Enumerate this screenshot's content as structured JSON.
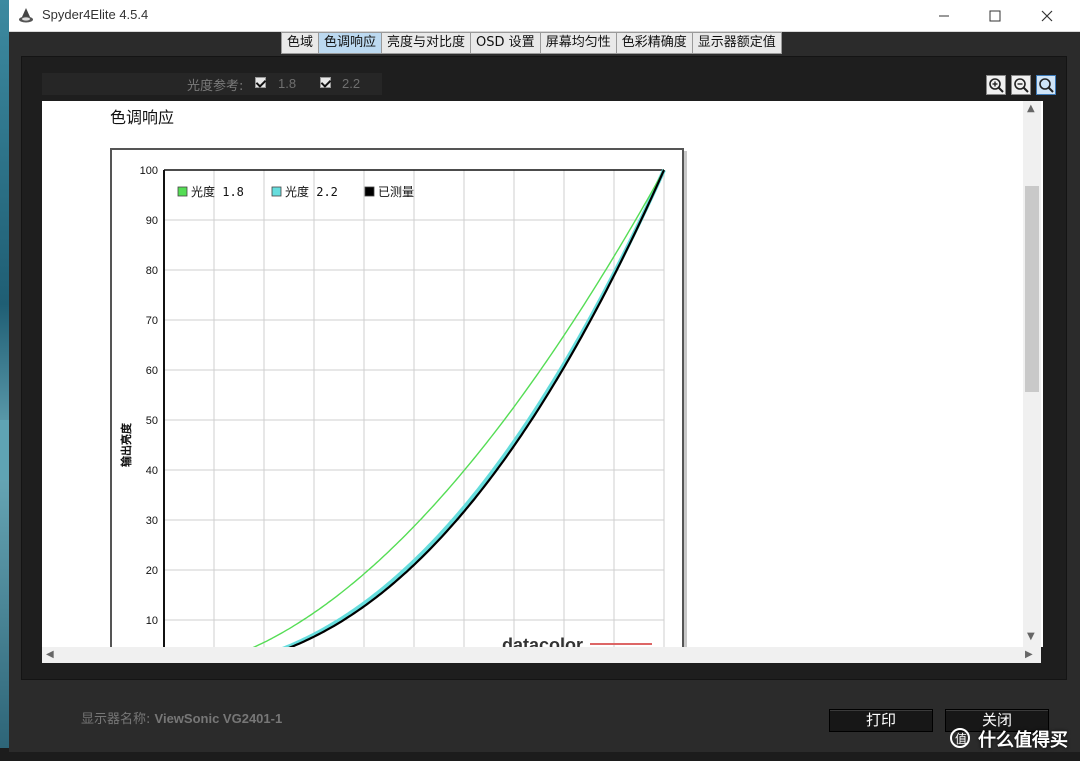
{
  "window": {
    "title": "Spyder4Elite 4.5.4",
    "min_icon": "minimize-icon",
    "max_icon": "maximize-icon",
    "close_icon": "close-icon"
  },
  "tabs": [
    {
      "label": "色域",
      "active": false
    },
    {
      "label": "色调响应",
      "active": true
    },
    {
      "label": "亮度与对比度",
      "active": false
    },
    {
      "label": "OSD 设置",
      "active": false
    },
    {
      "label": "屏幕均匀性",
      "active": false
    },
    {
      "label": "色彩精确度",
      "active": false
    },
    {
      "label": "显示器额定值",
      "active": false
    }
  ],
  "reference": {
    "label": "光度参考:",
    "options": [
      {
        "value": "1.8",
        "checked": true
      },
      {
        "value": "2.2",
        "checked": true
      }
    ]
  },
  "zoom": {
    "zoom_in_icon": "zoom-in-icon",
    "zoom_out_icon": "zoom-out-icon",
    "zoom_fit_icon": "zoom-fit-icon"
  },
  "section": {
    "title": "色调响应"
  },
  "chart_data": {
    "type": "line",
    "ylabel": "输出亮度",
    "xlabel": "",
    "ylim": [
      0,
      100
    ],
    "xlim": [
      0,
      100
    ],
    "yticks": [
      "10",
      "20",
      "30",
      "40",
      "50",
      "60",
      "70",
      "80",
      "90",
      "100"
    ],
    "grid": true,
    "legend_position": "top-left",
    "series": [
      {
        "name": "光度 1.8",
        "color": "#55dd55",
        "gamma": 1.8,
        "x": [
          40,
          50,
          60,
          70,
          80,
          90,
          100
        ],
        "y": [
          19.2,
          28.7,
          39.9,
          52.6,
          66.9,
          82.7,
          100
        ]
      },
      {
        "name": "光度 2.2",
        "color": "#66dddd",
        "gamma": 2.2,
        "x": [
          40,
          50,
          60,
          70,
          80,
          90,
          100
        ],
        "y": [
          13.3,
          21.8,
          32.5,
          45.6,
          61.2,
          79.3,
          100
        ]
      },
      {
        "name": "已测量",
        "color": "#000000",
        "gamma": 2.25,
        "x": [
          40,
          50,
          60,
          70,
          80,
          90,
          100
        ],
        "y": [
          12.6,
          21.0,
          31.6,
          44.8,
          60.5,
          78.9,
          100
        ]
      }
    ],
    "watermark": "datacolor"
  },
  "footer": {
    "monitor_label": "显示器名称:",
    "monitor_name": "ViewSonic VG2401-1",
    "print_label": "打印",
    "close_label": "关闭",
    "watermark_text": "什么值得买"
  }
}
